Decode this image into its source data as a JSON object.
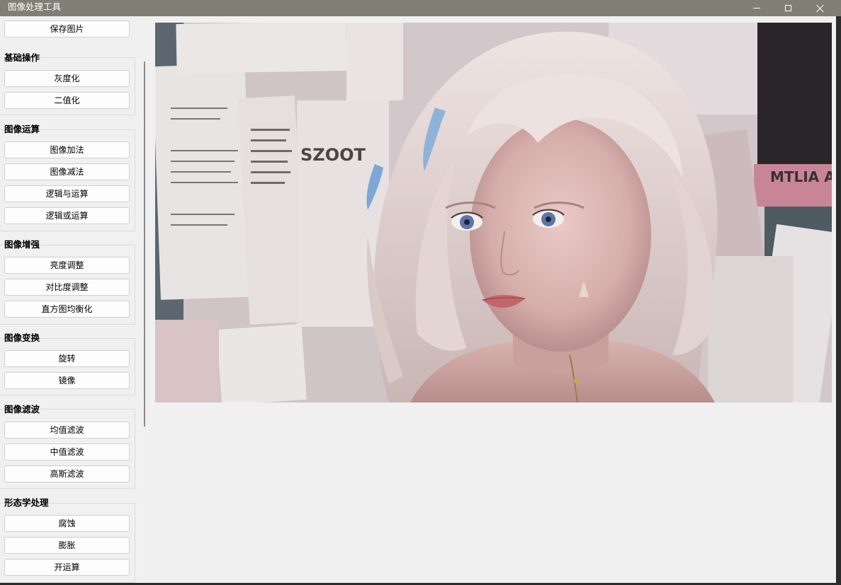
{
  "window": {
    "title": "图像处理工具"
  },
  "sidebar": {
    "top_button": "保存图片",
    "groups": [
      {
        "title": "基础操作",
        "buttons": [
          "灰度化",
          "二值化"
        ]
      },
      {
        "title": "图像运算",
        "buttons": [
          "图像加法",
          "图像减法",
          "逻辑与运算",
          "逻辑或运算"
        ]
      },
      {
        "title": "图像增强",
        "buttons": [
          "亮度调整",
          "对比度调整",
          "直方图均衡化"
        ]
      },
      {
        "title": "图像变换",
        "buttons": [
          "旋转",
          "镜像"
        ]
      },
      {
        "title": "图像滤波",
        "buttons": [
          "均值滤波",
          "中值滤波",
          "高斯滤波"
        ]
      },
      {
        "title": "形态学处理",
        "buttons": [
          "腐蚀",
          "膨胀",
          "开运算"
        ]
      }
    ]
  },
  "image": {
    "content_labels": [
      "SZOOT",
      "MTLIA A"
    ]
  },
  "icons": {
    "minimize": "minimize-icon",
    "maximize": "maximize-icon",
    "close": "close-icon"
  },
  "colors": {
    "titlebar": "#7f7f75",
    "background": "#f0f0f0"
  }
}
